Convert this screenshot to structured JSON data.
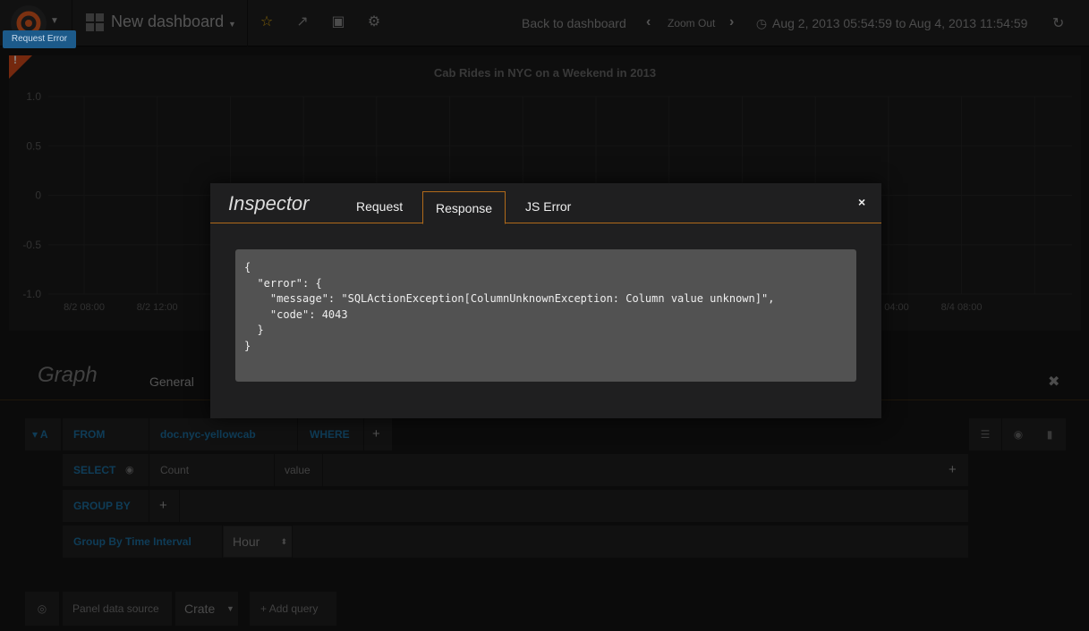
{
  "navbar": {
    "dashboard_title": "New dashboard",
    "back_label": "Back to dashboard",
    "zoom_out_label": "Zoom Out",
    "time_range": "Aug 2, 2013 05:54:59 to Aug 4, 2013 11:54:59",
    "accent_star": "#e5ac0e"
  },
  "error_tooltip": "Request Error",
  "panel_error_mark": "!",
  "chart_data": {
    "type": "line",
    "title": "Cab Rides in NYC on a Weekend in 2013",
    "xlabel": "",
    "ylabel": "",
    "ylim": [
      -1.0,
      1.0
    ],
    "y_ticks": [
      "1.0",
      "0.5",
      "0",
      "-0.5",
      "-1.0"
    ],
    "x_ticks_left": [
      "8/2 08:00",
      "8/2 12:00"
    ],
    "x_ticks_right": [
      "8/4 04:00",
      "8/4 08:00"
    ],
    "series": [],
    "grid": true
  },
  "editor": {
    "title": "Graph",
    "tab_general": "General",
    "row_letter": "A",
    "from_kw": "FROM",
    "table": "doc.nyc-yellowcab",
    "where_kw": "WHERE",
    "plus": "+",
    "select_kw": "SELECT",
    "agg": "Count",
    "column": "value",
    "groupby_kw": "GROUP BY",
    "interval_kw": "Group By Time Interval",
    "interval_value": "Hour",
    "ds_label": "Panel data source",
    "ds_value": "Crate",
    "add_query": "Add query"
  },
  "inspector": {
    "title": "Inspector",
    "tabs": [
      "Request",
      "Response",
      "JS Error"
    ],
    "active_tab": "Response",
    "close": "×",
    "response": "{\n  \"error\": {\n    \"message\": \"SQLActionException[ColumnUnknownException: Column value unknown]\",\n    \"code\": 4043\n  }\n}"
  }
}
